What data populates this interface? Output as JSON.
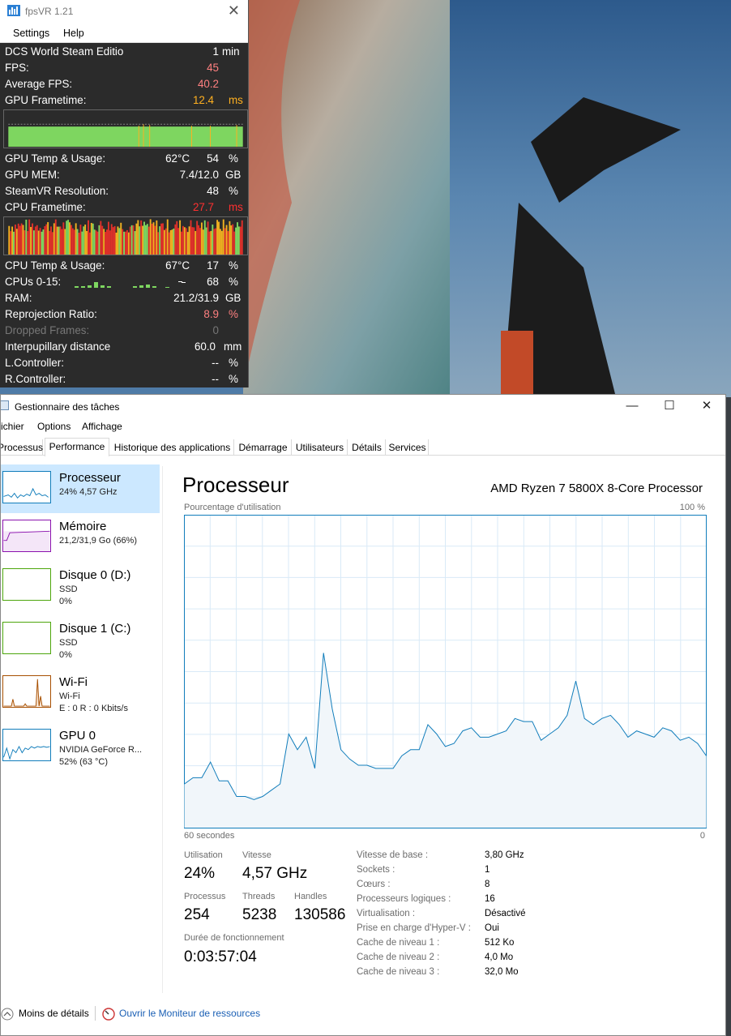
{
  "fpsvr": {
    "title": "fpsVR 1.21",
    "menu": [
      "Settings",
      "Help"
    ],
    "rows": [
      {
        "label": "DCS World Steam Editio",
        "value": "1",
        "unit": "min",
        "color": "#ffffff"
      },
      {
        "label": "FPS:",
        "value": "45",
        "unit": "",
        "color": "#ff8080"
      },
      {
        "label": "Average FPS:",
        "value": "40.2",
        "unit": "",
        "color": "#ff8080"
      },
      {
        "label": "GPU Frametime:",
        "value": "12.4",
        "unit": "ms",
        "color": "#ffb020"
      }
    ],
    "rows2": [
      {
        "label": "GPU Temp & Usage:",
        "temp": "62°C",
        "value": "54",
        "unit": "%"
      },
      {
        "label": "GPU MEM:",
        "value": "7.4/12.0",
        "unit": "GB"
      },
      {
        "label": "SteamVR Resolution:",
        "value": "48",
        "unit": "%"
      },
      {
        "label": "CPU Frametime:",
        "value": "27.7",
        "unit": "ms",
        "color": "#ff3030"
      }
    ],
    "rows3": [
      {
        "label": "CPU Temp & Usage:",
        "temp": "67°C",
        "value": "17",
        "unit": "%"
      },
      {
        "label": "CPUs 0-15:",
        "value": "68",
        "unit": "%"
      },
      {
        "label": "RAM:",
        "value": "21.2/31.9",
        "unit": "GB"
      },
      {
        "label": "Reprojection Ratio:",
        "value": "8.9",
        "unit": "%",
        "color": "#ff8080"
      },
      {
        "label": "Dropped Frames:",
        "value": "0",
        "unit": "",
        "dim": true
      },
      {
        "label": "Interpupillary distance",
        "value": "60.0",
        "unit": "mm"
      },
      {
        "label": "L.Controller:",
        "value": "--",
        "unit": "%"
      },
      {
        "label": "R.Controller:",
        "value": "--",
        "unit": "%"
      }
    ]
  },
  "taskmgr": {
    "title": "Gestionnaire des tâches",
    "menu": [
      "ichier",
      "Options",
      "Affichage"
    ],
    "tabs": [
      "Processus",
      "Performance",
      "Historique des applications",
      "Démarrage",
      "Utilisateurs",
      "Détails",
      "Services"
    ],
    "active_tab": "Performance",
    "sidebar": [
      {
        "name": "Processeur",
        "sub1": "24% 4,57 GHz",
        "sub2": "",
        "color": "#117dbb"
      },
      {
        "name": "Mémoire",
        "sub1": "21,2/31,9 Go (66%)",
        "sub2": "",
        "color": "#8b12ae"
      },
      {
        "name": "Disque 0 (D:)",
        "sub1": "SSD",
        "sub2": "0%",
        "color": "#4da60c"
      },
      {
        "name": "Disque 1 (C:)",
        "sub1": "SSD",
        "sub2": "0%",
        "color": "#4da60c"
      },
      {
        "name": "Wi-Fi",
        "sub1": "Wi-Fi",
        "sub2": "E : 0 R : 0 Kbits/s",
        "color": "#a74f01"
      },
      {
        "name": "GPU 0",
        "sub1": "NVIDIA GeForce R...",
        "sub2": "52% (63 °C)",
        "color": "#117dbb"
      }
    ],
    "main": {
      "heading": "Processeur",
      "cpu_name": "AMD Ryzen 7 5800X 8-Core Processor",
      "graph_label": "Pourcentage d'utilisation",
      "graph_max": "100 %",
      "graph_left": "60 secondes",
      "graph_right": "0",
      "utilisation_label": "Utilisation",
      "utilisation": "24%",
      "vitesse_label": "Vitesse",
      "vitesse": "4,57 GHz",
      "processus_label": "Processus",
      "processus": "254",
      "threads_label": "Threads",
      "threads": "5238",
      "handles_label": "Handles",
      "handles": "130586",
      "uptime_label": "Durée de fonctionnement",
      "uptime": "0:03:57:04",
      "specs": [
        {
          "k": "Vitesse de base :",
          "v": "3,80 GHz"
        },
        {
          "k": "Sockets :",
          "v": "1"
        },
        {
          "k": "Cœurs :",
          "v": "8"
        },
        {
          "k": "Processeurs logiques :",
          "v": "16"
        },
        {
          "k": "Virtualisation :",
          "v": "Désactivé"
        },
        {
          "k": "Prise en charge d'Hyper-V :",
          "v": "Oui"
        },
        {
          "k": "Cache de niveau 1 :",
          "v": "512 Ko"
        },
        {
          "k": "Cache de niveau 2 :",
          "v": "4,0 Mo"
        },
        {
          "k": "Cache de niveau 3 :",
          "v": "32,0 Mo"
        }
      ]
    },
    "footer": {
      "less": "Moins de détails",
      "monitor": "Ouvrir le Moniteur de ressources"
    }
  },
  "chart_data": {
    "type": "area",
    "title": "",
    "xlabel": "",
    "ylabel": "Pourcentage d'utilisation",
    "xlim": [
      60,
      0
    ],
    "ylim": [
      0,
      100
    ],
    "grid": true,
    "color": "#117dbb",
    "series": [
      {
        "values": [
          14,
          16,
          16,
          21,
          15,
          15,
          10,
          10,
          9,
          10,
          12,
          14,
          30,
          25,
          29,
          19,
          56,
          38,
          25,
          22,
          20,
          20,
          19,
          19,
          19,
          23,
          25,
          25,
          33,
          30,
          26,
          27,
          31,
          32,
          29,
          29,
          30,
          31,
          35,
          34,
          34,
          28,
          30,
          32,
          36,
          47,
          35,
          33,
          35,
          36,
          33,
          29,
          31,
          30,
          29,
          32,
          31,
          28,
          29,
          27,
          23
        ]
      }
    ]
  }
}
